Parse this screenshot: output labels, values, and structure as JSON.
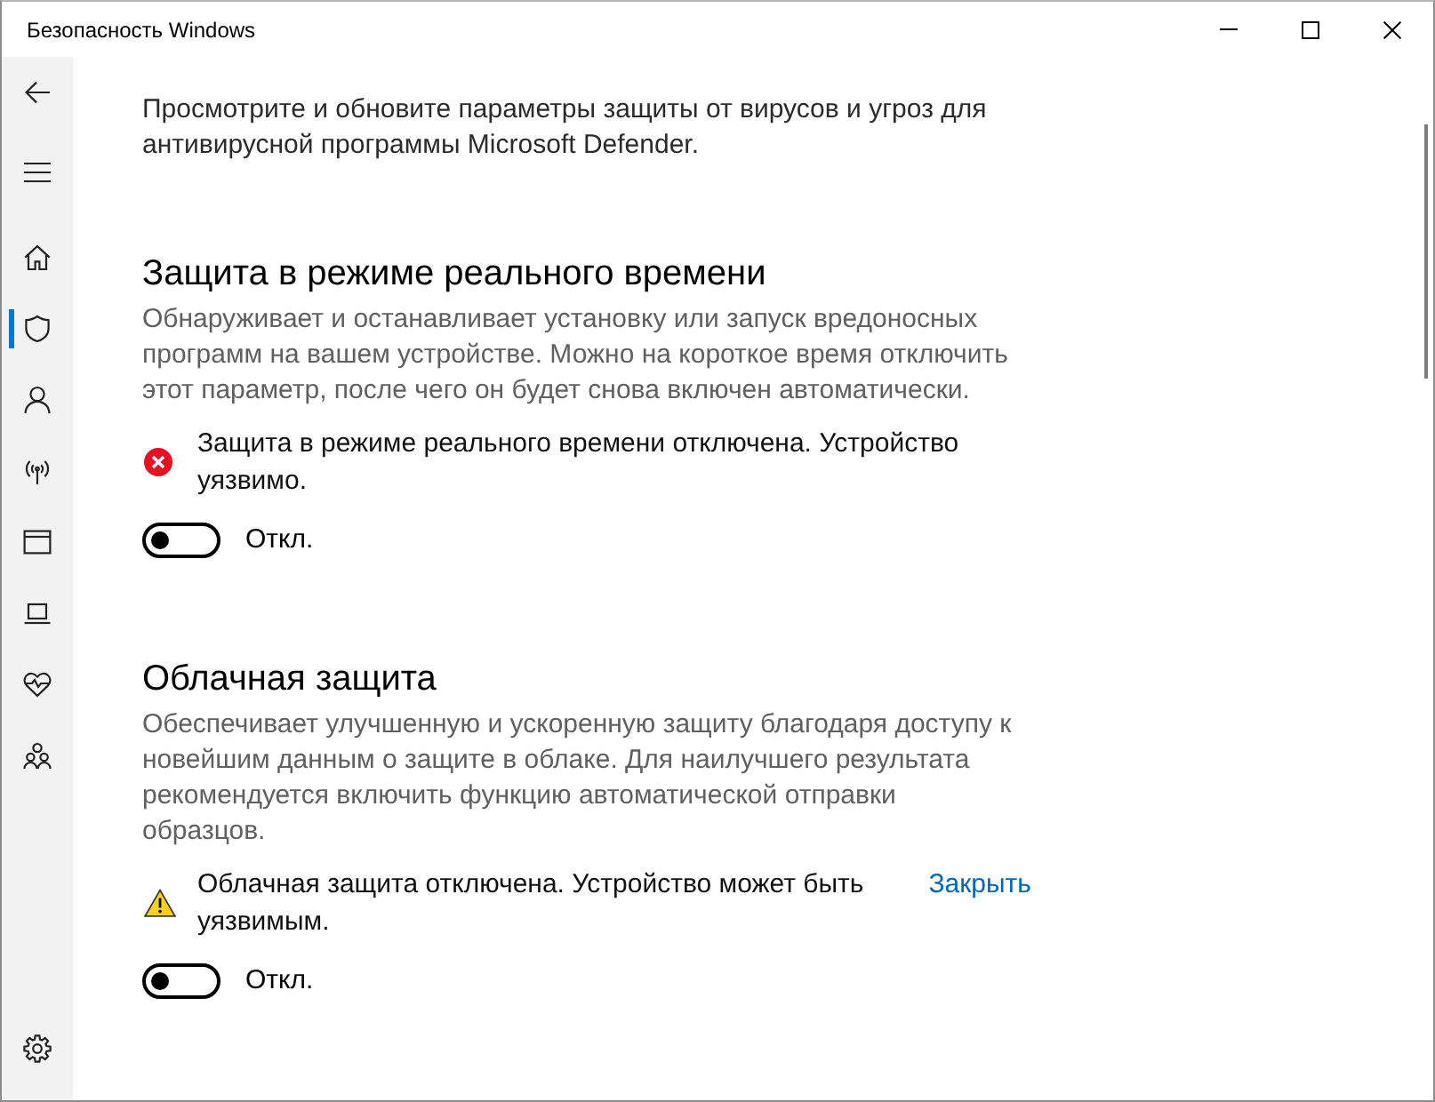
{
  "window": {
    "title": "Безопасность Windows"
  },
  "sidebar": {
    "top_buttons": [
      {
        "kind": "back"
      },
      {
        "kind": "menu"
      }
    ],
    "items": [
      {
        "kind": "home",
        "selected": false
      },
      {
        "kind": "protection",
        "selected": true
      },
      {
        "kind": "account",
        "selected": false
      },
      {
        "kind": "network",
        "selected": false
      },
      {
        "kind": "app-browser",
        "selected": false
      },
      {
        "kind": "device",
        "selected": false
      },
      {
        "kind": "health",
        "selected": false
      },
      {
        "kind": "family",
        "selected": false
      }
    ],
    "bottom_items": [
      {
        "kind": "settings",
        "selected": false
      }
    ]
  },
  "intro": "Просмотрите и обновите параметры защиты от вирусов и угроз для антивирусной программы Microsoft Defender.",
  "sections": [
    {
      "title": "Защита в режиме реального времени",
      "description": "Обнаруживает и останавливает установку или запуск вредоносных программ на вашем устройстве. Можно на короткое время отключить этот параметр, после чего он будет снова включен автоматически.",
      "alert": {
        "kind": "error",
        "text": "Защита в режиме реального времени отключена. Устройство уязвимо."
      },
      "toggle": {
        "on": false,
        "label": "Откл."
      }
    },
    {
      "title": "Облачная защита",
      "description": "Обеспечивает улучшенную и ускоренную защиту благодаря доступу к новейшим данным о защите в облаке. Для наилучшего результата рекомендуется включить функцию автоматической отправки образцов.",
      "alert": {
        "kind": "warning",
        "text": "Облачная защита отключена. Устройство может быть уязвимым.",
        "action": "Закрыть"
      },
      "toggle": {
        "on": false,
        "label": "Откл."
      }
    }
  ]
}
